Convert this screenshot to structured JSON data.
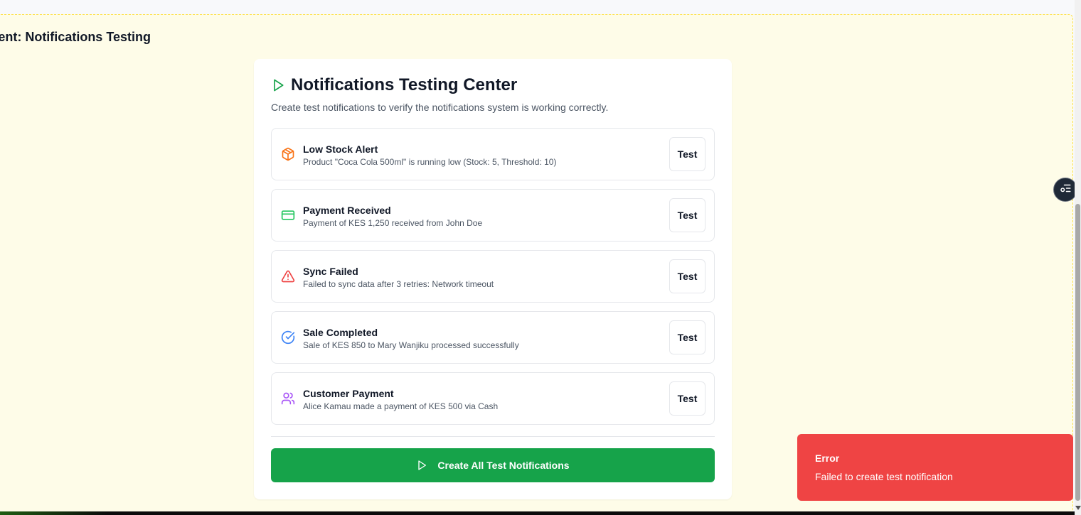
{
  "dev_panel": {
    "title": "Development: Notifications Testing"
  },
  "card": {
    "title": "Notifications Testing Center",
    "description": "Create test notifications to verify the notifications system is working correctly.",
    "title_icon": "play-icon",
    "accent_color": "#16a34a"
  },
  "notifications": [
    {
      "title": "Low Stock Alert",
      "description": "Product \"Coca Cola 500ml\" is running low (Stock: 5, Threshold: 10)",
      "icon": "package-icon",
      "color": "#f97316",
      "button": "Test"
    },
    {
      "title": "Payment Received",
      "description": "Payment of KES 1,250 received from John Doe",
      "icon": "credit-card-icon",
      "color": "#22c55e",
      "button": "Test"
    },
    {
      "title": "Sync Failed",
      "description": "Failed to sync data after 3 retries: Network timeout",
      "icon": "alert-triangle-icon",
      "color": "#ef4444",
      "button": "Test"
    },
    {
      "title": "Sale Completed",
      "description": "Sale of KES 850 to Mary Wanjiku processed successfully",
      "icon": "check-circle-icon",
      "color": "#3b82f6",
      "button": "Test"
    },
    {
      "title": "Customer Payment",
      "description": "Alice Kamau made a payment of KES 500 via Cash",
      "icon": "users-icon",
      "color": "#a855f7",
      "button": "Test"
    }
  ],
  "create_all_button": {
    "label": "Create All Test Notifications",
    "icon": "play-icon"
  },
  "toast": {
    "title": "Error",
    "description": "Failed to create test notification",
    "color": "#ef4444"
  },
  "floating_button": {
    "icon": "settings-list-icon"
  }
}
